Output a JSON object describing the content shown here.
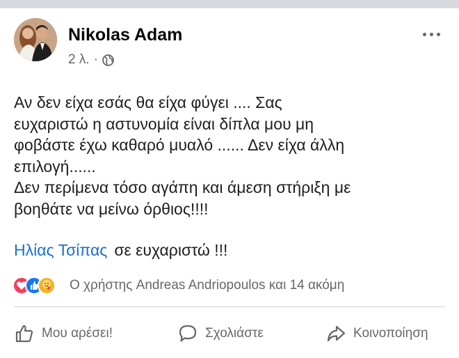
{
  "post": {
    "author": "Nikolas Adam",
    "time": "2 λ.",
    "separator": "·",
    "body": "Αν δεν είχα εσάς θα είχα φύγει .... Σας\nευχαριστώ η αστυνομία είναι δίπλα μου μη\nφοβάστε έχω καθαρό μυαλό ...... Δεν είχα άλλη\nεπιλογή......\nΔεν περίμενα τόσο αγάπη και άμεση στήριξη με\nβοηθάτε να μείνω όρθιος!!!!",
    "mention": "Ηλίας Τσίπας",
    "mention_suffix": "σε ευχαριστώ !!!"
  },
  "reactions": {
    "icons": [
      "love-icon",
      "like-icon",
      "care-icon"
    ],
    "summary": "Ο χρήστης Andreas Andriopoulos και 14 ακόμη"
  },
  "actions": {
    "like": "Μου αρέσει!",
    "comment": "Σχολιάστε",
    "share": "Κοινοποίηση"
  },
  "colors": {
    "link": "#1a6fd1",
    "secondary_text": "#65676b",
    "love": "#f33e58",
    "like": "#1877f2",
    "care": "#f7b125"
  }
}
